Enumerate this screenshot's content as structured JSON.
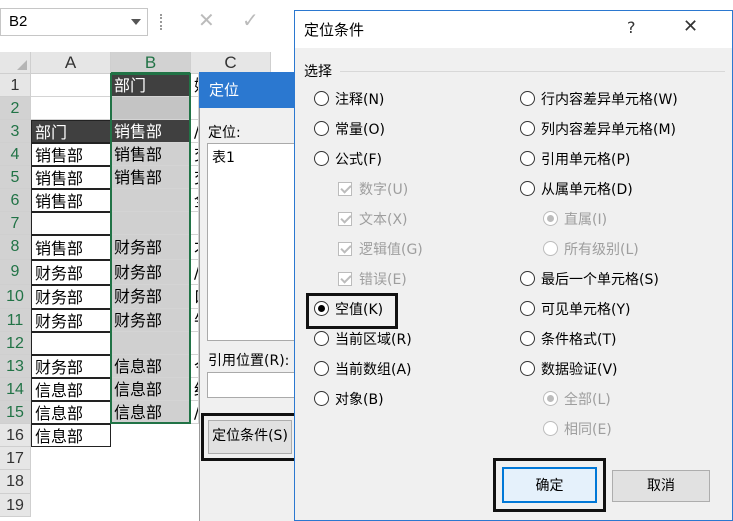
{
  "formula_bar": {
    "name_box": "B2",
    "cancel_glyph": "✕",
    "enter_glyph": "✓"
  },
  "sheet": {
    "columns": [
      "A",
      "B",
      "C"
    ],
    "rows": [
      "1",
      "2",
      "3",
      "4",
      "5",
      "6",
      "7",
      "8",
      "9",
      "10",
      "11",
      "12",
      "13",
      "14",
      "15",
      "16",
      "17",
      "18",
      "19"
    ],
    "col_a": [
      "",
      "",
      "部门",
      "销售部",
      "销售部",
      "销售部",
      "",
      "销售部",
      "财务部",
      "财务部",
      "财务部",
      "",
      "财务部",
      "信息部",
      "信息部",
      "信息部"
    ],
    "col_b": [
      "部门",
      "",
      "销售部",
      "销售部",
      "销售部",
      "",
      "",
      "财务部",
      "财务部",
      "财务部",
      "财务部",
      "",
      "信息部",
      "信息部",
      "信息部"
    ],
    "col_c": [
      "姓",
      "",
      "/",
      "交",
      "交",
      "全",
      "",
      "才",
      "/",
      "口",
      "牛",
      "",
      "今",
      "红",
      "/"
    ]
  },
  "goto_dialog": {
    "title": "定位",
    "goto_label": "定位:",
    "list_items": [
      "表1"
    ],
    "reference_label": "引用位置(R):",
    "special_button": "定位条件(S)"
  },
  "special_dialog": {
    "title": "定位条件",
    "help": "?",
    "close": "✕",
    "group_label": "选择",
    "left_options": [
      {
        "label": "注释(N)",
        "type": "radio",
        "selected": false,
        "enabled": true
      },
      {
        "label": "常量(O)",
        "type": "radio",
        "selected": false,
        "enabled": true
      },
      {
        "label": "公式(F)",
        "type": "radio",
        "selected": false,
        "enabled": true
      },
      {
        "label": "数字(U)",
        "type": "checkbox",
        "selected": true,
        "enabled": false
      },
      {
        "label": "文本(X)",
        "type": "checkbox",
        "selected": true,
        "enabled": false
      },
      {
        "label": "逻辑值(G)",
        "type": "checkbox",
        "selected": true,
        "enabled": false
      },
      {
        "label": "错误(E)",
        "type": "checkbox",
        "selected": true,
        "enabled": false
      },
      {
        "label": "空值(K)",
        "type": "radio",
        "selected": true,
        "enabled": true
      },
      {
        "label": "当前区域(R)",
        "type": "radio",
        "selected": false,
        "enabled": true
      },
      {
        "label": "当前数组(A)",
        "type": "radio",
        "selected": false,
        "enabled": true
      },
      {
        "label": "对象(B)",
        "type": "radio",
        "selected": false,
        "enabled": true
      }
    ],
    "right_options": [
      {
        "label": "行内容差异单元格(W)",
        "type": "radio",
        "selected": false,
        "enabled": true
      },
      {
        "label": "列内容差异单元格(M)",
        "type": "radio",
        "selected": false,
        "enabled": true
      },
      {
        "label": "引用单元格(P)",
        "type": "radio",
        "selected": false,
        "enabled": true
      },
      {
        "label": "从属单元格(D)",
        "type": "radio",
        "selected": false,
        "enabled": true
      },
      {
        "label": "直属(I)",
        "type": "radio",
        "selected": true,
        "enabled": false
      },
      {
        "label": "所有级别(L)",
        "type": "radio",
        "selected": false,
        "enabled": false
      },
      {
        "label": "最后一个单元格(S)",
        "type": "radio",
        "selected": false,
        "enabled": true
      },
      {
        "label": "可见单元格(Y)",
        "type": "radio",
        "selected": false,
        "enabled": true
      },
      {
        "label": "条件格式(T)",
        "type": "radio",
        "selected": false,
        "enabled": true
      },
      {
        "label": "数据验证(V)",
        "type": "radio",
        "selected": false,
        "enabled": true
      },
      {
        "label": "全部(L)",
        "type": "radio",
        "selected": true,
        "enabled": false
      },
      {
        "label": "相同(E)",
        "type": "radio",
        "selected": false,
        "enabled": false
      }
    ],
    "ok": "确定",
    "cancel": "取消"
  }
}
